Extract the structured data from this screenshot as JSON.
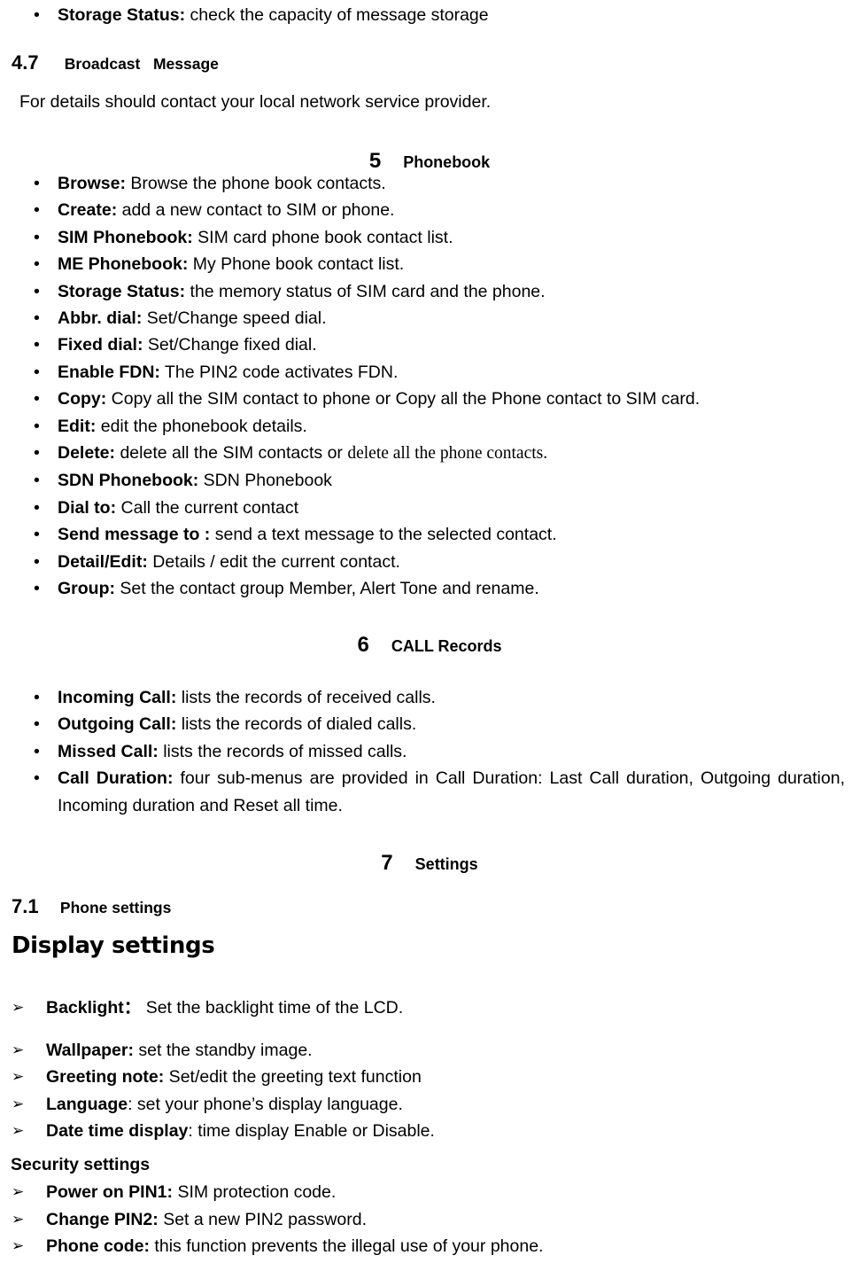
{
  "document": {
    "top_item": {
      "term": "Storage Status:",
      "desc": " check the capacity of message storage"
    },
    "section_4_7": {
      "number": "4.7",
      "gap": "      ",
      "title": "Broadcast   Message",
      "body": "For details should contact your local network service provider."
    },
    "chapter_5": {
      "number": "5",
      "gap": "     ",
      "title": "Phonebook",
      "items": [
        {
          "term": "Browse:",
          "desc": " Browse the phone book contacts."
        },
        {
          "term": "Create:",
          "desc": " add a new contact to SIM or phone."
        },
        {
          "term": "SIM Phonebook:",
          "desc": " SIM card phone book contact list."
        },
        {
          "term": "ME Phonebook:",
          "desc": " My Phone book contact list."
        },
        {
          "term": "Storage Status:",
          "desc": " the memory status of SIM card and the phone."
        },
        {
          "term": "Abbr. dial:",
          "desc": " Set/Change speed dial."
        },
        {
          "term": "Fixed dial:",
          "desc": " Set/Change fixed dial."
        },
        {
          "term": "Enable FDN:",
          "desc": " The PIN2 code activates FDN."
        },
        {
          "term": "Copy:",
          "desc": " Copy all the SIM contact to phone or Copy all the Phone contact to SIM card."
        },
        {
          "term": "Edit:",
          "desc": " edit the phonebook details."
        },
        {
          "term": "Delete:",
          "desc": " delete all the SIM contacts or ",
          "desc_serif": "delete all the phone contacts."
        },
        {
          "term": "SDN Phonebook:",
          "desc": " SDN Phonebook"
        },
        {
          "term": "Dial to:",
          "desc": " Call the current contact"
        },
        {
          "term": "Send message to :",
          "desc": " send a text message to the selected contact."
        },
        {
          "term": "Detail/Edit:",
          "desc": " Details / edit the current contact."
        },
        {
          "term": "Group:",
          "desc": " Set the contact group Member, Alert Tone and rename."
        }
      ]
    },
    "chapter_6": {
      "number": "6",
      "gap": "     ",
      "title": "CALL Records",
      "items": [
        {
          "term": "Incoming Call:",
          "desc": " lists the records of received calls."
        },
        {
          "term": "Outgoing Call:",
          "desc": " lists the records of dialed calls."
        },
        {
          "term": "Missed Call:",
          "desc": " lists the records of missed calls."
        },
        {
          "term": "Call Duration:",
          "desc": " four sub-menus are provided in Call Duration: Last Call duration, Outgoing duration, Incoming duration and Reset all time."
        }
      ]
    },
    "chapter_7": {
      "number": "7",
      "gap": "     ",
      "title": "Settings"
    },
    "section_7_1": {
      "number": "7.1",
      "gap": "     ",
      "title": "Phone settings"
    },
    "display_settings": {
      "heading": "Display settings",
      "items": [
        {
          "term": "Backlight：",
          "desc": " Set the backlight time of the LCD."
        },
        {
          "term": "Wallpaper:",
          "desc": " set the standby image."
        },
        {
          "term": "Greeting note:",
          "desc": " Set/edit the greeting text function"
        },
        {
          "term": "Language",
          "desc": ": set your phone’s display language."
        },
        {
          "term": "Date time display",
          "desc": ": time display Enable or Disable."
        }
      ]
    },
    "security_settings": {
      "heading": "Security settings",
      "items": [
        {
          "term": "Power on PIN1:",
          "desc": " SIM protection code."
        },
        {
          "term": "Change PIN2:",
          "desc": " Set a new PIN2 password."
        },
        {
          "term": "Phone code:",
          "desc": " this function prevents the illegal use of your phone."
        }
      ]
    }
  }
}
